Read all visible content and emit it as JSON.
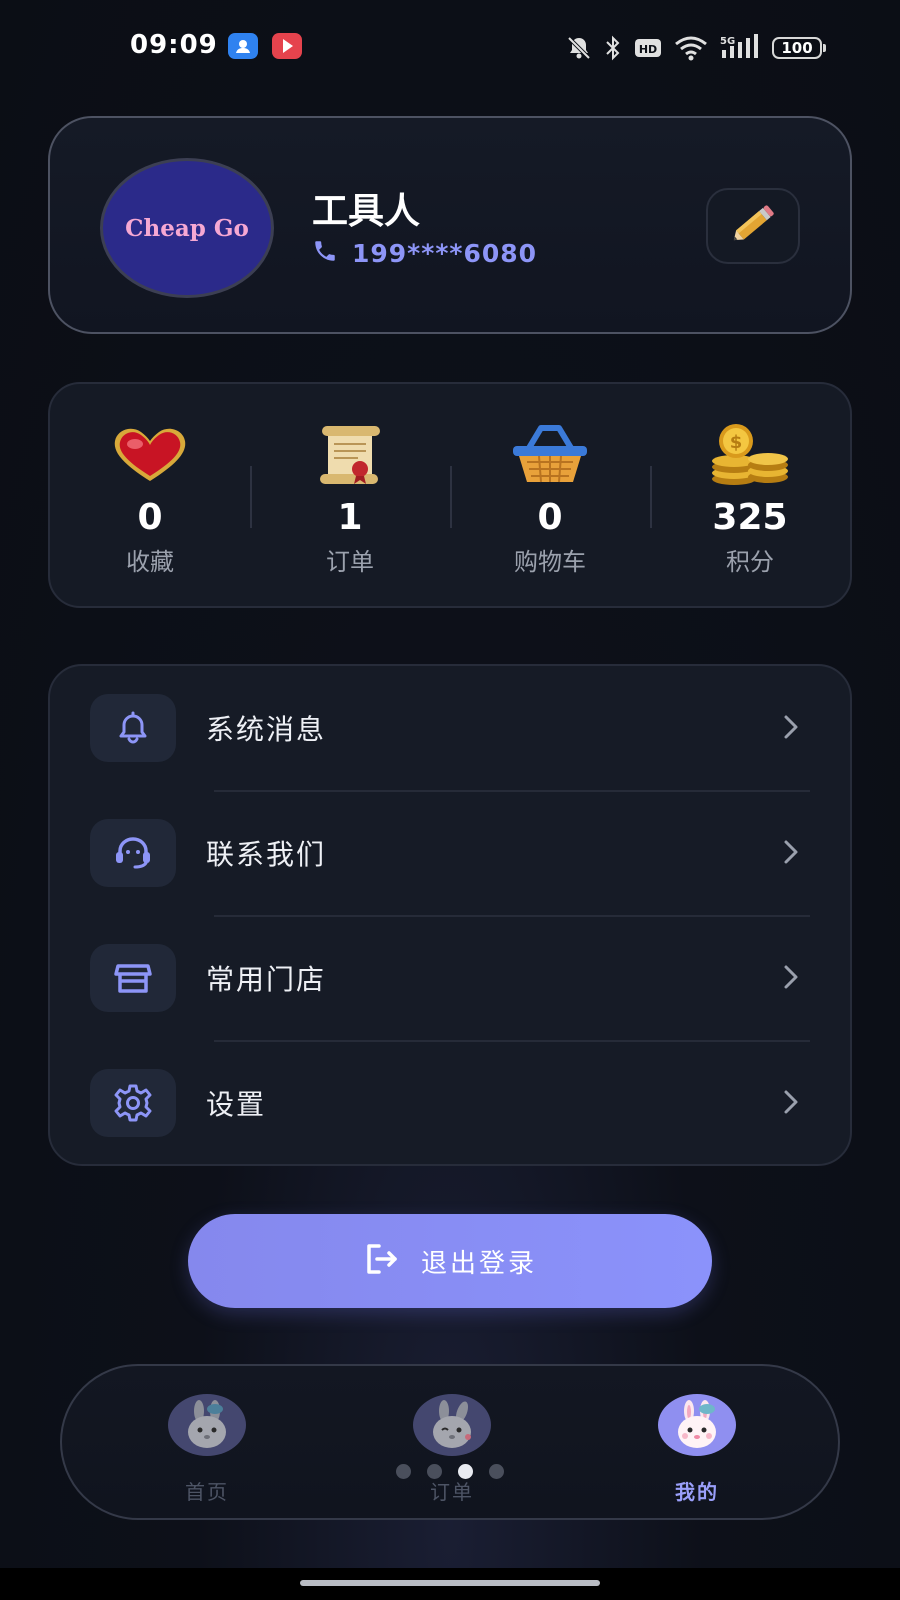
{
  "status_bar": {
    "time": "09:09",
    "network_type": "5G",
    "hd_label": "HD",
    "battery_level": "100"
  },
  "profile": {
    "avatar_text": "Cheap Go",
    "name": "工具人",
    "phone": "199****6080"
  },
  "stats": [
    {
      "value": "0",
      "label": "收藏",
      "icon": "heart-icon"
    },
    {
      "value": "1",
      "label": "订单",
      "icon": "scroll-icon"
    },
    {
      "value": "0",
      "label": "购物车",
      "icon": "basket-icon"
    },
    {
      "value": "325",
      "label": "积分",
      "icon": "coins-icon"
    }
  ],
  "menu": [
    {
      "label": "系统消息",
      "icon": "bell-icon"
    },
    {
      "label": "联系我们",
      "icon": "headset-icon"
    },
    {
      "label": "常用门店",
      "icon": "store-icon"
    },
    {
      "label": "设置",
      "icon": "gear-icon"
    }
  ],
  "logout": {
    "label": "退出登录",
    "icon": "logout-icon"
  },
  "bottom_nav": {
    "items": [
      {
        "label": "首页",
        "active": false
      },
      {
        "label": "订单",
        "active": false
      },
      {
        "label": "我的",
        "active": true
      }
    ],
    "page_indicator": {
      "count": 4,
      "current": 3
    }
  },
  "colors": {
    "accent": "#8b92fb",
    "background": "#0b0e15",
    "card": "#151a25",
    "phone_text": "#8d95f7"
  }
}
